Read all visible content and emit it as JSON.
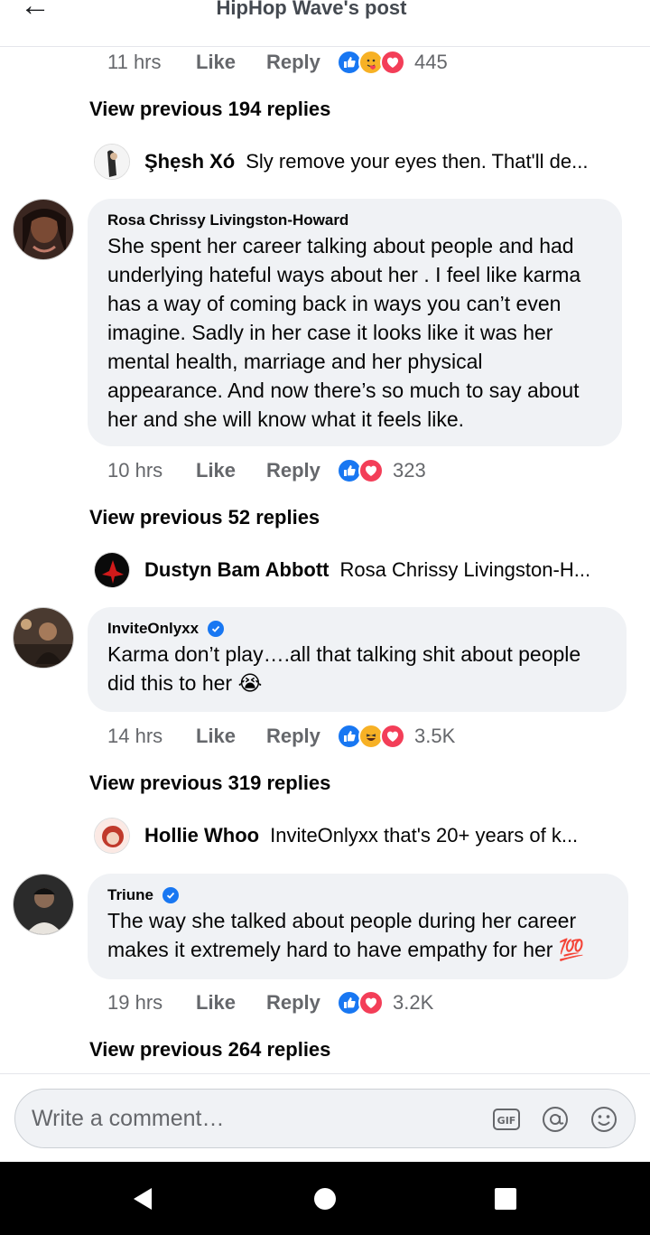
{
  "header": {
    "title": "HipHop Wave's post",
    "back_icon": "arrow-left-icon"
  },
  "comments": [
    {
      "time": "11 hrs",
      "like": "Like",
      "reply": "Reply",
      "reactions": [
        "like",
        "care",
        "love"
      ],
      "count": "445",
      "view_previous": "View previous 194 replies",
      "latest_reply": {
        "name": "Şhẹsh Xó",
        "text": "Sly remove your eyes then. That'll de..."
      }
    },
    {
      "author": "Rosa Chrissy Livingston-Howard",
      "verified": false,
      "text": "She spent her career talking about people and had underlying hateful ways about her . I feel like karma has a way of coming back in ways you can’t even imagine. Sadly in her case it looks like it was her mental health, marriage and her physical appearance. And now there’s so much to say about her and she will know what it feels like.",
      "time": "10 hrs",
      "like": "Like",
      "reply": "Reply",
      "reactions": [
        "like",
        "love"
      ],
      "count": "323",
      "view_previous": "View previous 52 replies",
      "latest_reply": {
        "name": "Dustyn Bam Abbott",
        "text": "Rosa Chrissy Livingston-H..."
      }
    },
    {
      "author": "InviteOnlyxx",
      "verified": true,
      "text": "Karma don’t play….all that talking shit about people did this to her 😭",
      "time": "14 hrs",
      "like": "Like",
      "reply": "Reply",
      "reactions": [
        "like",
        "haha",
        "love"
      ],
      "count": "3.5K",
      "view_previous": "View previous 319 replies",
      "latest_reply": {
        "name": "Hollie Whoo",
        "text": "InviteOnlyxx that's 20+ years of k..."
      }
    },
    {
      "author": "Triune",
      "verified": true,
      "text": "The way she talked about people during her career makes it extremely hard to have empathy for her 💯",
      "time": "19 hrs",
      "like": "Like",
      "reply": "Reply",
      "reactions": [
        "like",
        "love"
      ],
      "count": "3.2K",
      "view_previous": "View previous 264 replies"
    }
  ],
  "composer": {
    "placeholder": "Write a comment…",
    "icons": [
      "gif-icon",
      "mention-icon",
      "emoji-icon"
    ]
  },
  "navbar": {
    "icons": [
      "back-triangle-icon",
      "home-circle-icon",
      "recents-square-icon"
    ]
  },
  "colors": {
    "like_blue": "#1877f2",
    "love_red": "#f33e58",
    "bubble_bg": "#f0f2f5",
    "meta_gray": "#65676b"
  }
}
